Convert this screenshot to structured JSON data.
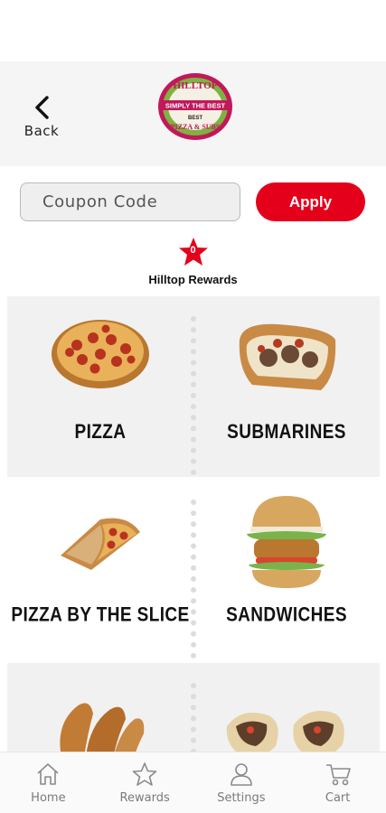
{
  "header": {
    "back_label": "Back",
    "logo_text": [
      "HILLTOP",
      "SIMPLY THE BEST",
      "PIZZA & SUBS"
    ]
  },
  "coupon": {
    "placeholder": "Coupon Code",
    "apply_label": "Apply"
  },
  "rewards": {
    "count": "0",
    "label": "Hilltop Rewards"
  },
  "categories": [
    {
      "label": "PIZZA",
      "icon": "pizza-image"
    },
    {
      "label": "SUBMARINES",
      "icon": "submarine-image"
    },
    {
      "label": "PIZZA BY THE SLICE",
      "icon": "pizza-slice-image"
    },
    {
      "label": "SANDWICHES",
      "icon": "sandwich-image"
    },
    {
      "label": "",
      "icon": "wings-image"
    },
    {
      "label": "",
      "icon": "wraps-image"
    }
  ],
  "tabbar": {
    "items": [
      {
        "label": "Home",
        "icon": "home-icon"
      },
      {
        "label": "Rewards",
        "icon": "star-icon"
      },
      {
        "label": "Settings",
        "icon": "user-icon"
      },
      {
        "label": "Cart",
        "icon": "cart-icon"
      }
    ]
  },
  "colors": {
    "brand_red": "#e4001b",
    "logo_pink": "#c2185b",
    "logo_green": "#7fb241",
    "header_bg": "#f5f5f5",
    "tile_bg": "#f1f1f1"
  }
}
